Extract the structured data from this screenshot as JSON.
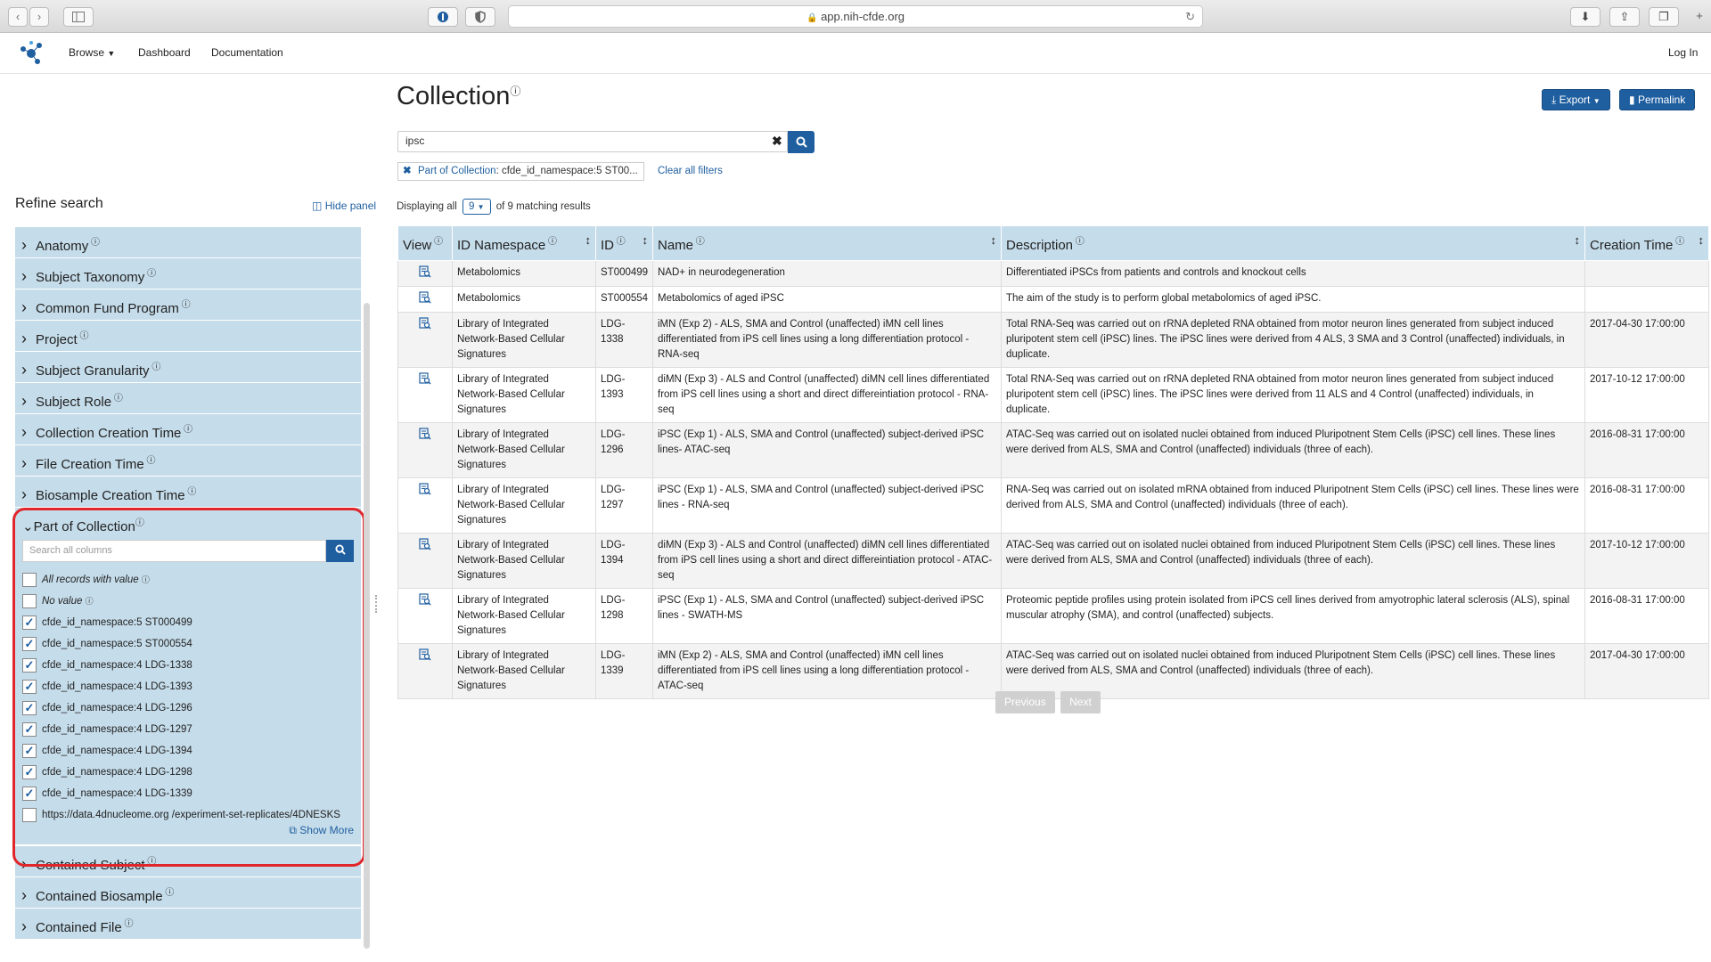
{
  "browser": {
    "url": "app.nih-cfde.org",
    "back_icon": "‹",
    "forward_icon": "›"
  },
  "nav": {
    "browse": "Browse",
    "dashboard": "Dashboard",
    "documentation": "Documentation",
    "login": "Log In"
  },
  "page": {
    "title": "Collection",
    "info": "ⓘ",
    "export_label": "Export",
    "permalink_label": "Permalink",
    "search_value": "ipsc",
    "filter_chip_label": "Part of Collection",
    "filter_chip_value": ": cfde_id_namespace:5 ST00...",
    "clear_all": "Clear all filters",
    "displaying_prefix": "Displaying all",
    "page_size": "9",
    "displaying_suffix": "of 9 matching results"
  },
  "sidebar": {
    "title": "Refine search",
    "hide_panel": "Hide panel",
    "facets_top": [
      "Anatomy",
      "Subject Taxonomy",
      "Common Fund Program",
      "Project",
      "Subject Granularity",
      "Subject Role",
      "Collection Creation Time",
      "File Creation Time",
      "Biosample Creation Time"
    ],
    "open_facet": {
      "label": "Part of Collection",
      "search_placeholder": "Search all columns",
      "all_records": "All records with value",
      "no_value": "No value",
      "options": [
        "cfde_id_namespace:5 ST000499",
        "cfde_id_namespace:5 ST000554",
        "cfde_id_namespace:4 LDG-1338",
        "cfde_id_namespace:4 LDG-1393",
        "cfde_id_namespace:4 LDG-1296",
        "cfde_id_namespace:4 LDG-1297",
        "cfde_id_namespace:4 LDG-1394",
        "cfde_id_namespace:4 LDG-1298",
        "cfde_id_namespace:4 LDG-1339",
        "https://data.4dnucleome.org /experiment-set-replicates/4DNESKS"
      ],
      "checked": [
        true,
        true,
        true,
        true,
        true,
        true,
        true,
        true,
        true,
        false
      ],
      "show_more": "Show More"
    },
    "facets_bottom": [
      "Contained Subject",
      "Contained Biosample",
      "Contained File"
    ]
  },
  "table": {
    "headers": [
      "View",
      "ID Namespace",
      "ID",
      "Name",
      "Description",
      "Creation Time"
    ],
    "rows": [
      [
        "Metabolomics",
        "ST000499",
        "NAD+ in neurodegeneration",
        "Differentiated iPSCs from patients and controls and knockout cells",
        ""
      ],
      [
        "Metabolomics",
        "ST000554",
        "Metabolomics of aged iPSC",
        "The aim of the study is to perform global metabolomics of aged iPSC.",
        ""
      ],
      [
        "Library of Integrated Network-Based Cellular Signatures",
        "LDG-1338",
        "iMN (Exp 2) - ALS, SMA and Control (unaffected) iMN cell lines differentiated from iPS cell lines using a long differentiation protocol - RNA-seq",
        "Total RNA-Seq was carried out on rRNA depleted RNA obtained from motor neuron lines generated from subject induced pluripotent stem cell (iPSC) lines. The iPSC lines were derived from 4 ALS, 3 SMA and 3 Control (unaffected) individuals, in duplicate.",
        "2017-04-30 17:00:00"
      ],
      [
        "Library of Integrated Network-Based Cellular Signatures",
        "LDG-1393",
        "diMN (Exp 3) - ALS and Control (unaffected) diMN cell lines differentiated from iPS cell lines using a short and direct differeintiation protocol - RNA-seq",
        "Total RNA-Seq was carried out on rRNA depleted RNA obtained from motor neuron lines generated from subject induced pluripotent stem cell (iPSC) lines. The iPSC lines were derived from 11 ALS and 4 Control (unaffected) individuals, in duplicate.",
        "2017-10-12 17:00:00"
      ],
      [
        "Library of Integrated Network-Based Cellular Signatures",
        "LDG-1296",
        "iPSC (Exp 1) - ALS, SMA and Control (unaffected) subject-derived iPSC lines- ATAC-seq",
        "ATAC-Seq was carried out on isolated nuclei obtained from induced Pluripotnent Stem Cells (iPSC) cell lines. These lines were derived from ALS, SMA and Control (unaffected) individuals (three of each).",
        "2016-08-31 17:00:00"
      ],
      [
        "Library of Integrated Network-Based Cellular Signatures",
        "LDG-1297",
        "iPSC (Exp 1) - ALS, SMA and Control (unaffected) subject-derived iPSC lines - RNA-seq",
        "RNA-Seq was carried out on isolated mRNA obtained from induced Pluripotnent Stem Cells (iPSC) cell lines. These lines were derived from ALS, SMA and Control (unaffected) individuals (three of each).",
        "2016-08-31 17:00:00"
      ],
      [
        "Library of Integrated Network-Based Cellular Signatures",
        "LDG-1394",
        "diMN (Exp 3) - ALS and Control (unaffected) diMN cell lines differentiated from iPS cell lines using a short and direct differeintiation protocol - ATAC-seq",
        "ATAC-Seq was carried out on isolated nuclei obtained from induced Pluripotnent Stem Cells (iPSC) cell lines. These lines were derived from ALS, SMA and Control (unaffected) individuals (three of each).",
        "2017-10-12 17:00:00"
      ],
      [
        "Library of Integrated Network-Based Cellular Signatures",
        "LDG-1298",
        "iPSC (Exp 1) - ALS, SMA and Control (unaffected) subject-derived iPSC lines - SWATH-MS",
        "Proteomic peptide profiles using protein isolated from iPCS cell lines derived from amyotrophic lateral sclerosis (ALS), spinal muscular atrophy (SMA), and control (unaffected) subjects.",
        "2016-08-31 17:00:00"
      ],
      [
        "Library of Integrated Network-Based Cellular Signatures",
        "LDG-1339",
        "iMN (Exp 2) - ALS, SMA and Control (unaffected) iMN cell lines differentiated from iPS cell lines using a long differentiation protocol - ATAC-seq",
        "ATAC-Seq was carried out on isolated nuclei obtained from induced Pluripotnent Stem Cells (iPSC) cell lines. These lines were derived from ALS, SMA and Control (unaffected) individuals (three of each).",
        "2017-04-30 17:00:00"
      ]
    ]
  },
  "pager": {
    "previous": "Previous",
    "next": "Next"
  }
}
